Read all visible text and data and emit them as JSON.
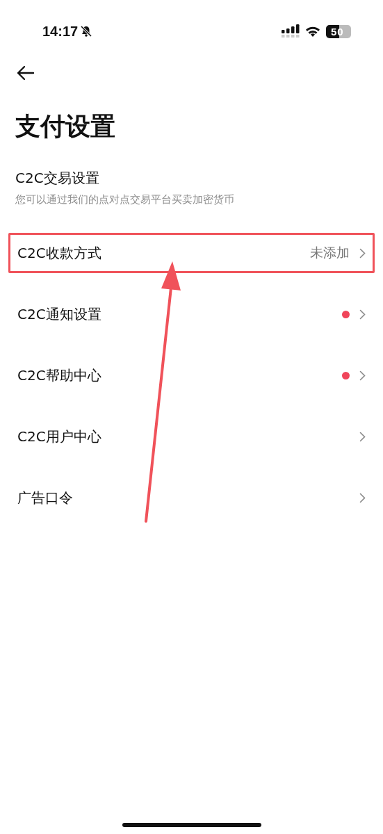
{
  "status_bar": {
    "time": "14:17",
    "silent": true,
    "battery": "50"
  },
  "header": {
    "title": "支付设置"
  },
  "section": {
    "title": "C2C交易设置",
    "description": "您可以通过我们的点对点交易平台买卖加密货币"
  },
  "rows": [
    {
      "label": "C2C收款方式",
      "value": "未添加",
      "unread": false,
      "highlighted": true
    },
    {
      "label": "C2C通知设置",
      "unread": true,
      "highlighted": false
    },
    {
      "label": "C2C帮助中心",
      "unread": true,
      "highlighted": false
    },
    {
      "label": "C2C用户中心",
      "unread": false,
      "highlighted": false
    },
    {
      "label": "广告口令",
      "unread": false,
      "highlighted": false
    }
  ]
}
